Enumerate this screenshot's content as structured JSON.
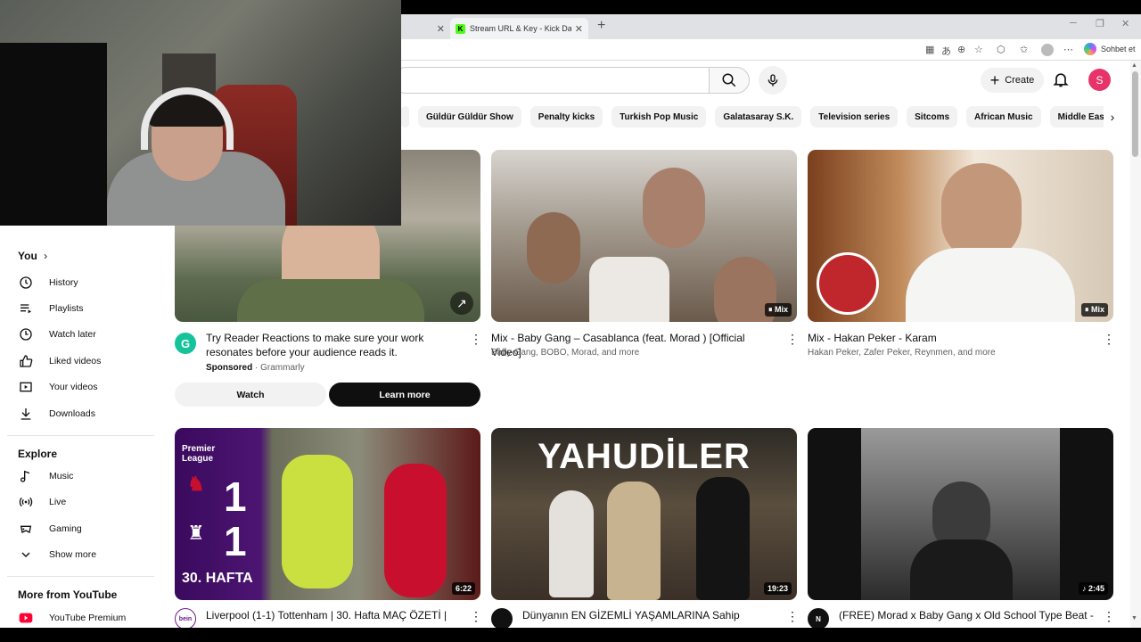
{
  "browser": {
    "tabs": [
      {
        "label": ""
      },
      {
        "label": "Stream URL & Key - Kick Dashboard",
        "favicon": "K"
      }
    ],
    "new_tab": "+",
    "copilot_label": "Sohbet et"
  },
  "header": {
    "create_label": "Create",
    "avatar_letter": "S"
  },
  "chips": [
    "Güldür Güldür Show",
    "Penalty kicks",
    "Turkish Pop Music",
    "Galatasaray S.K.",
    "Television series",
    "Sitcoms",
    "African Music",
    "Middle Eastern Mu"
  ],
  "sidebar": {
    "you_heading": "You",
    "you_items": [
      {
        "label": "History",
        "icon": "history-icon"
      },
      {
        "label": "Playlists",
        "icon": "playlists-icon"
      },
      {
        "label": "Watch later",
        "icon": "watch-later-icon"
      },
      {
        "label": "Liked videos",
        "icon": "liked-icon"
      },
      {
        "label": "Your videos",
        "icon": "your-videos-icon"
      },
      {
        "label": "Downloads",
        "icon": "download-icon"
      }
    ],
    "explore_heading": "Explore",
    "explore_items": [
      {
        "label": "Music",
        "icon": "music-icon"
      },
      {
        "label": "Live",
        "icon": "live-icon"
      },
      {
        "label": "Gaming",
        "icon": "gaming-icon"
      },
      {
        "label": "Show more",
        "icon": "chevron-down-icon"
      }
    ],
    "more_heading": "More from YouTube",
    "more_items": [
      {
        "label": "YouTube Premium",
        "icon": "youtube-premium-icon"
      }
    ]
  },
  "videos": {
    "ad": {
      "title": "Try Reader Reactions to make sure your work resonates before your audience reads it.",
      "sponsored": "Sponsored",
      "advertiser": "Grammarly",
      "watch_label": "Watch",
      "learn_label": "Learn more"
    },
    "v2": {
      "title": "Mix - Baby Gang – Casablanca (feat. Morad ) [Official Video]",
      "meta": "Baby Gang, BOBO, Morad, and more",
      "badge": "Mix"
    },
    "v3": {
      "title": "Mix - Hakan Peker - Karam",
      "meta": "Hakan Peker, Zafer Peker, Reynmen, and more",
      "badge": "Mix"
    },
    "v4": {
      "title": "Liverpool (1-1) Tottenham | 30. Hafta MAÇ ÖZETİ |",
      "duration": "6:22",
      "overlay_league": "Premier League",
      "overlay_week": "30. HAFTA",
      "score_home": "1",
      "score_away": "1"
    },
    "v5": {
      "title": "Dünyanın EN GİZEMLİ YAŞAMLARINA Sahip",
      "duration": "19:23",
      "overlay_text": "YAHUDİLER"
    },
    "v6": {
      "title": "(FREE) Morad x Baby Gang x Old School Type Beat -",
      "duration": "2:45"
    }
  }
}
